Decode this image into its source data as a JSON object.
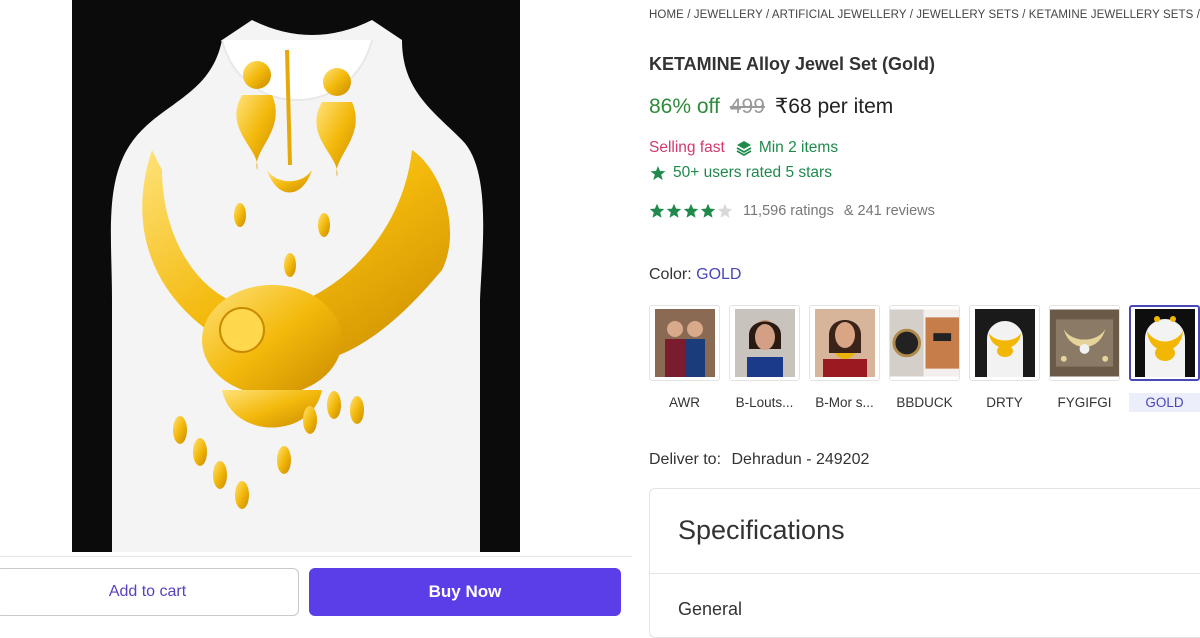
{
  "breadcrumb": "HOME / JEWELLERY / ARTIFICIAL JEWELLERY / JEWELLERY SETS / KETAMINE JEWELLERY SETS / K",
  "product": {
    "title": "KETAMINE Alloy Jewel Set (Gold)",
    "discount": "86% off",
    "mrp": "499",
    "price": "₹68 per item",
    "selling_fast": "Selling fast",
    "min_items": "Min 2 items",
    "users_rated": "50+ users rated 5 stars",
    "rating_value": 4,
    "rating_max": 5,
    "ratings_count": "11,596 ratings",
    "reviews_count": "& 241 reviews"
  },
  "color": {
    "label": "Color:",
    "selected": "GOLD",
    "options": [
      {
        "label": "AWR",
        "icon": "women-in-sarees-photo"
      },
      {
        "label": "B-Louts...",
        "icon": "woman-portrait-photo"
      },
      {
        "label": "B-Mor s...",
        "icon": "woman-red-saree-photo"
      },
      {
        "label": "BBDUCK",
        "icon": "wristwatch-photo"
      },
      {
        "label": "DRTY",
        "icon": "gold-necklace-photo"
      },
      {
        "label": "FYGIFGI",
        "icon": "jewellery-set-photo"
      },
      {
        "label": "GOLD",
        "icon": "gold-necklace-dark-photo"
      }
    ]
  },
  "delivery": {
    "label": "Deliver to:",
    "place": "Dehradun - 249202"
  },
  "specifications": {
    "title": "Specifications",
    "first_section": "General"
  },
  "actions": {
    "add_to_cart": "Add to cart",
    "buy_now": "Buy Now"
  },
  "colors": {
    "accent": "#5b3ee8",
    "discount_green": "#2e8b3a",
    "selling_fast_pink": "#d13a6b",
    "star_green": "#1f8a4c",
    "gold": "#f2b705"
  }
}
